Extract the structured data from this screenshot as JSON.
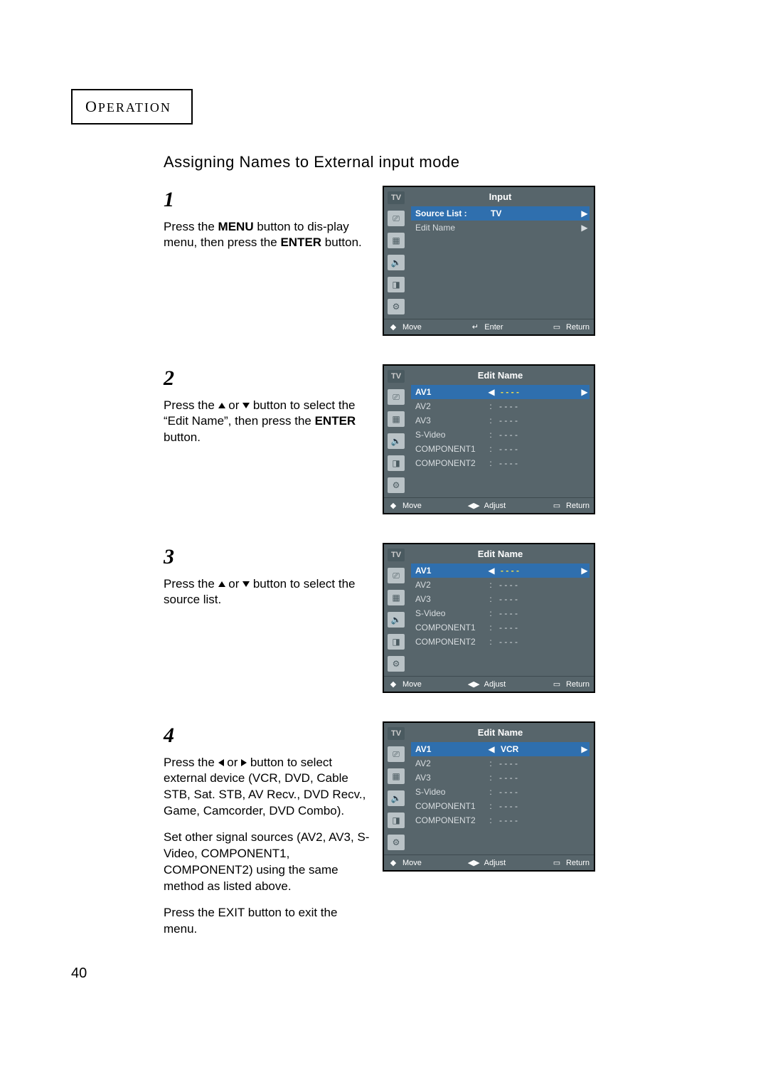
{
  "header": {
    "op1": "O",
    "op2": "PERATION",
    "subtitle": "Assigning Names to External input mode"
  },
  "page_number": "40",
  "osd": {
    "tv": "TV",
    "foot": {
      "move": "Move",
      "enter": "Enter",
      "adjust": "Adjust",
      "return": "Return"
    }
  },
  "steps": [
    {
      "num": "1",
      "t1": "Press the ",
      "b1": "MENU",
      "t2": " button to dis-play menu, then press the ",
      "b2": "ENTER",
      "t3": " button."
    },
    {
      "num": "2",
      "t1": "Press the ",
      "t2": " or ",
      "t3": " button to select the “Edit Name”, then press the ",
      "b1": "ENTER",
      "t4": " button."
    },
    {
      "num": "3",
      "t1": "Press the ",
      "t2": " or ",
      "t3": " button to select the source list."
    },
    {
      "num": "4",
      "t1": "Press the ",
      "t2": " or ",
      "t3": " button to select external device (VCR, DVD, Cable STB, Sat. STB, AV Recv., DVD Recv., Game, Camcorder, DVD Combo).",
      "p2": "Set other signal sources (AV2, AV3, S-Video, COMPONENT1, COMPONENT2) using the same method as listed above.",
      "p3": "Press the EXIT button to exit the menu."
    }
  ],
  "osd1": {
    "title": "Input",
    "rows": [
      {
        "label": "Source List :",
        "value": "TV"
      },
      {
        "label": "Edit Name",
        "value": ""
      }
    ]
  },
  "osd2": {
    "title": "Edit Name",
    "rows": [
      {
        "label": "AV1",
        "value": "- - - -"
      },
      {
        "label": "AV2",
        "value": "- - - -"
      },
      {
        "label": "AV3",
        "value": "- - - -"
      },
      {
        "label": "S-Video",
        "value": "- - - -"
      },
      {
        "label": "COMPONENT1",
        "value": "- - - -"
      },
      {
        "label": "COMPONENT2",
        "value": "- - - -"
      }
    ]
  },
  "osd3": {
    "title": "Edit Name",
    "rows": [
      {
        "label": "AV1",
        "value": "- - - -"
      },
      {
        "label": "AV2",
        "value": "- - - -"
      },
      {
        "label": "AV3",
        "value": "- - - -"
      },
      {
        "label": "S-Video",
        "value": "- - - -"
      },
      {
        "label": "COMPONENT1",
        "value": "- - - -"
      },
      {
        "label": "COMPONENT2",
        "value": "- - - -"
      }
    ]
  },
  "osd4": {
    "title": "Edit Name",
    "rows": [
      {
        "label": "AV1",
        "value": "VCR"
      },
      {
        "label": "AV2",
        "value": "- - - -"
      },
      {
        "label": "AV3",
        "value": "- - - -"
      },
      {
        "label": "S-Video",
        "value": "- - - -"
      },
      {
        "label": "COMPONENT1",
        "value": "- - - -"
      },
      {
        "label": "COMPONENT2",
        "value": "- - - -"
      }
    ]
  }
}
